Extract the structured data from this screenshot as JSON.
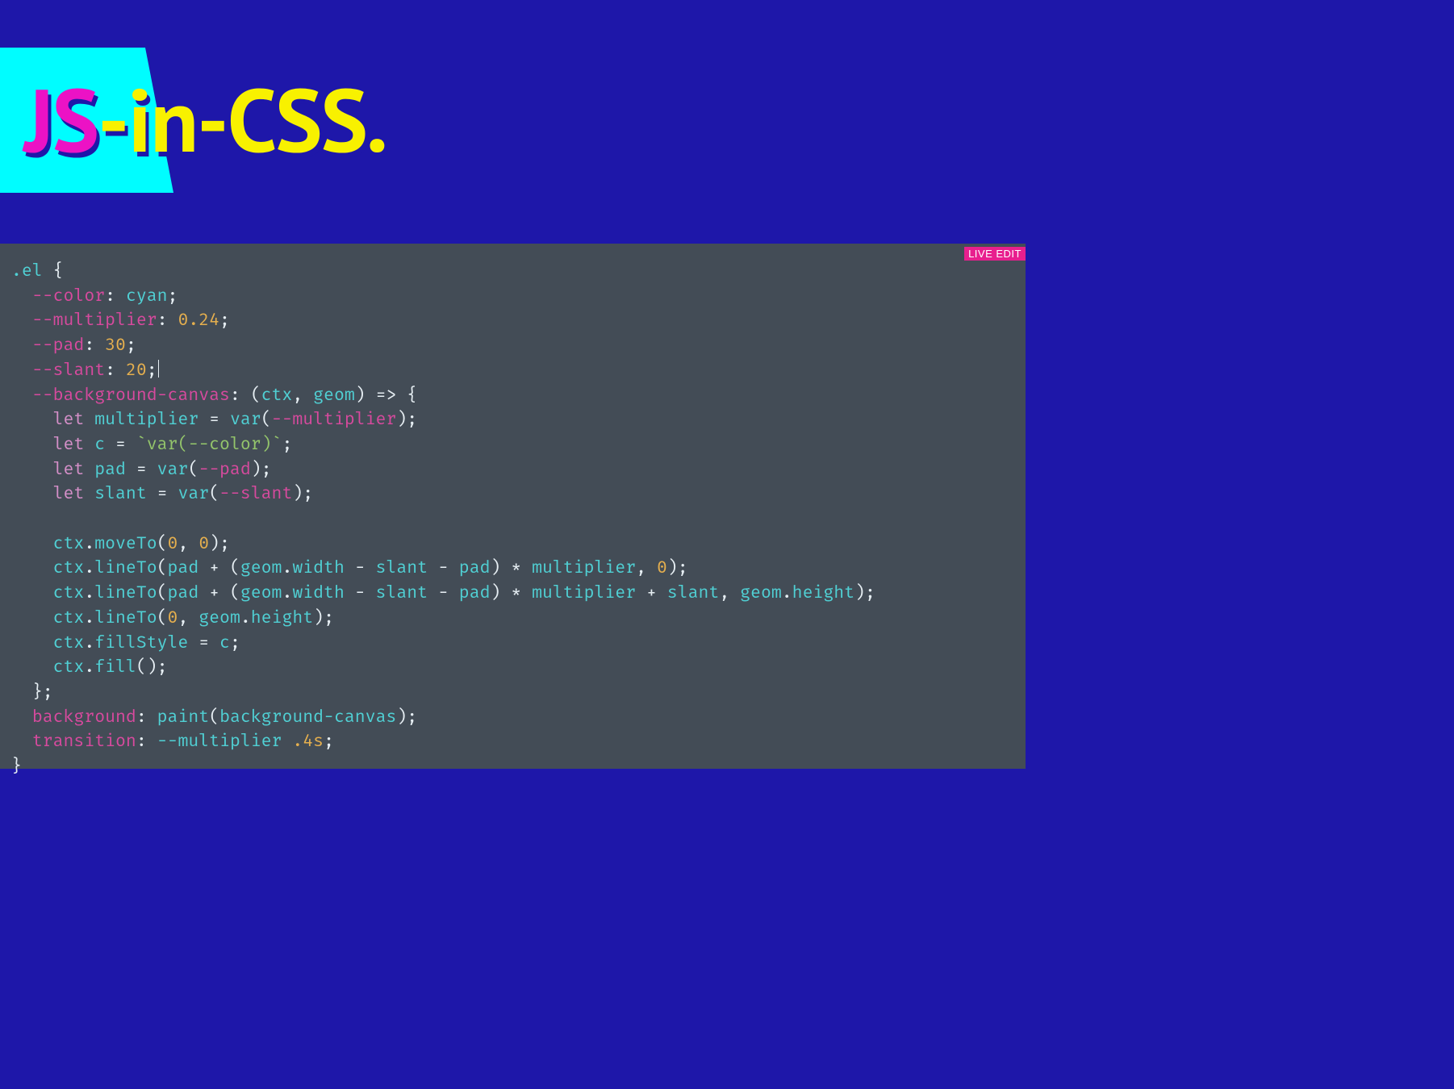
{
  "hero": {
    "title_js": "JS",
    "title_rest": "-in-CSS."
  },
  "editor": {
    "badge": "LIVE EDIT",
    "code": {
      "l01_a": ".el",
      "l01_b": " {",
      "l02_a": "--color",
      "l02_b": ": ",
      "l02_c": "cyan",
      "l02_d": ";",
      "l03_a": "--multiplier",
      "l03_b": ": ",
      "l03_c": "0.24",
      "l03_d": ";",
      "l04_a": "--pad",
      "l04_b": ": ",
      "l04_c": "30",
      "l04_d": ";",
      "l05_a": "--slant",
      "l05_b": ": ",
      "l05_c": "20",
      "l05_d": ";",
      "l06_a": "--background-canvas",
      "l06_b": ": (",
      "l06_c": "ctx",
      "l06_d": ", ",
      "l06_e": "geom",
      "l06_f": ") ",
      "l06_g": "=>",
      "l06_h": " {",
      "l07_a": "let",
      "l07_b": " ",
      "l07_c": "multiplier",
      "l07_d": " = ",
      "l07_e": "var",
      "l07_f": "(",
      "l07_g": "--multiplier",
      "l07_h": ");",
      "l08_a": "let",
      "l08_b": " ",
      "l08_c": "c",
      "l08_d": " = ",
      "l08_e": "`var(--color)`",
      "l08_f": ";",
      "l09_a": "let",
      "l09_b": " ",
      "l09_c": "pad",
      "l09_d": " = ",
      "l09_e": "var",
      "l09_f": "(",
      "l09_g": "--pad",
      "l09_h": ");",
      "l10_a": "let",
      "l10_b": " ",
      "l10_c": "slant",
      "l10_d": " = ",
      "l10_e": "var",
      "l10_f": "(",
      "l10_g": "--slant",
      "l10_h": ");",
      "l12_a": "ctx",
      "l12_b": ".",
      "l12_c": "moveTo",
      "l12_d": "(",
      "l12_e": "0",
      "l12_f": ", ",
      "l12_g": "0",
      "l12_h": ");",
      "l13_a": "ctx",
      "l13_b": ".",
      "l13_c": "lineTo",
      "l13_d": "(",
      "l13_e": "pad",
      "l13_f": " + (",
      "l13_g": "geom",
      "l13_h": ".",
      "l13_i": "width",
      "l13_j": " - ",
      "l13_k": "slant",
      "l13_l": " - ",
      "l13_m": "pad",
      "l13_n": ") * ",
      "l13_o": "multiplier",
      "l13_p": ", ",
      "l13_q": "0",
      "l13_r": ");",
      "l14_a": "ctx",
      "l14_b": ".",
      "l14_c": "lineTo",
      "l14_d": "(",
      "l14_e": "pad",
      "l14_f": " + (",
      "l14_g": "geom",
      "l14_h": ".",
      "l14_i": "width",
      "l14_j": " - ",
      "l14_k": "slant",
      "l14_l": " - ",
      "l14_m": "pad",
      "l14_n": ") * ",
      "l14_o": "multiplier",
      "l14_p": " + ",
      "l14_q": "slant",
      "l14_r": ", ",
      "l14_s": "geom",
      "l14_t": ".",
      "l14_u": "height",
      "l14_v": ");",
      "l15_a": "ctx",
      "l15_b": ".",
      "l15_c": "lineTo",
      "l15_d": "(",
      "l15_e": "0",
      "l15_f": ", ",
      "l15_g": "geom",
      "l15_h": ".",
      "l15_i": "height",
      "l15_j": ");",
      "l16_a": "ctx",
      "l16_b": ".",
      "l16_c": "fillStyle",
      "l16_d": " = ",
      "l16_e": "c",
      "l16_f": ";",
      "l17_a": "ctx",
      "l17_b": ".",
      "l17_c": "fill",
      "l17_d": "();",
      "l18_a": "};",
      "l19_a": "background",
      "l19_b": ": ",
      "l19_c": "paint",
      "l19_d": "(",
      "l19_e": "background-canvas",
      "l19_f": ");",
      "l20_a": "transition",
      "l20_b": ": ",
      "l20_c": "--multiplier",
      "l20_d": " ",
      "l20_e": ".4s",
      "l20_f": ";",
      "l21_a": "}"
    }
  }
}
